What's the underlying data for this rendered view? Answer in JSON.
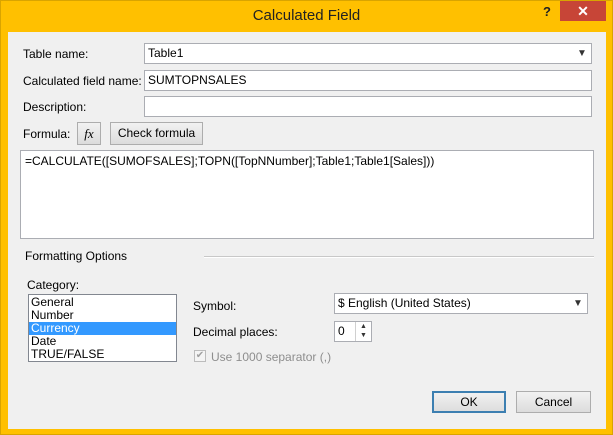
{
  "window": {
    "title": "Calculated Field",
    "help_label": "?",
    "close_label": "✕"
  },
  "form": {
    "table_name_label": "Table name:",
    "table_name_value": "Table1",
    "calc_field_label": "Calculated field name:",
    "calc_field_value": "SUMTOPNSALES",
    "description_label": "Description:",
    "description_value": "",
    "formula_label": "Formula:",
    "fx_label": "fx",
    "check_formula_label": "Check formula",
    "formula_text": "=CALCULATE([SUMOFSALES];TOPN([TopNNumber];Table1;Table1[Sales]))"
  },
  "formatting": {
    "section_label": "Formatting Options",
    "category_label": "Category:",
    "categories": [
      {
        "label": "General",
        "selected": false
      },
      {
        "label": "Number",
        "selected": false
      },
      {
        "label": "Currency",
        "selected": true
      },
      {
        "label": "Date",
        "selected": false
      },
      {
        "label": "TRUE/FALSE",
        "selected": false
      }
    ],
    "symbol_label": "Symbol:",
    "symbol_value": "$ English (United States)",
    "decimal_label": "Decimal places:",
    "decimal_value": "0",
    "separator_label": "Use 1000 separator (,)",
    "separator_checked": true
  },
  "buttons": {
    "ok_label": "OK",
    "cancel_label": "Cancel"
  },
  "colors": {
    "titlebar": "#ffc000",
    "close": "#c74537",
    "selection": "#3399ff"
  }
}
